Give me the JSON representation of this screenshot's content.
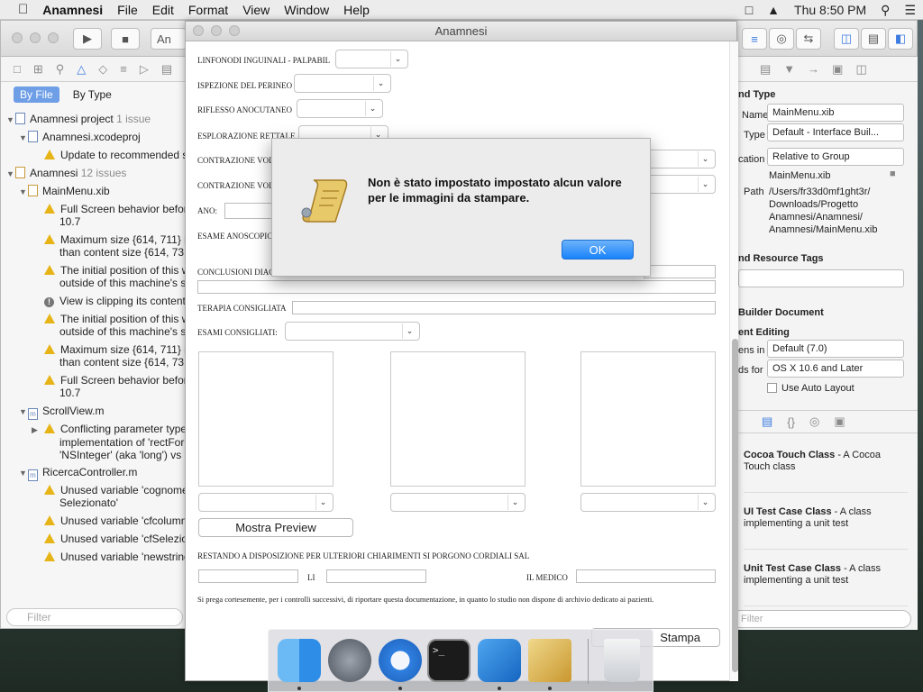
{
  "menubar": {
    "app_name": "Anamnesi",
    "menus": [
      "File",
      "Edit",
      "Format",
      "View",
      "Window",
      "Help"
    ],
    "clock": "Thu 8:50 PM"
  },
  "xcode": {
    "tab_partial": "An",
    "navigator": {
      "seg_by_file": "By File",
      "seg_by_type": "By Type",
      "rows": [
        {
          "text": "Anamnesi project",
          "badge": "1 issue",
          "type": "project"
        },
        {
          "text": "Anamnesi.xcodeproj",
          "type": "file"
        },
        {
          "text": "Update to recommended s",
          "type": "warning"
        },
        {
          "text": "Anamnesi",
          "badge": "12 issues",
          "type": "project"
        },
        {
          "text": "MainMenu.xib",
          "type": "file"
        },
        {
          "text": "Full Screen behavior before",
          "text2": "10.7",
          "type": "warning"
        },
        {
          "text": "Maximum size {614, 711} is",
          "text2": "than content size {614, 731",
          "type": "warning"
        },
        {
          "text": "The initial position of this w",
          "text2": "outside of this machine's s",
          "type": "warning"
        },
        {
          "text": "View is clipping its content",
          "type": "error"
        },
        {
          "text": "The initial position of this w",
          "text2": "outside of this machine's s",
          "type": "warning"
        },
        {
          "text": "Maximum size {614, 711} is",
          "text2": "than content size {614, 731",
          "type": "warning"
        },
        {
          "text": "Full Screen behavior before",
          "text2": "10.7",
          "type": "warning"
        },
        {
          "text": "ScrollView.m",
          "type": "file"
        },
        {
          "text": "Conflicting parameter type",
          "text2": "implementation of 'rectFor",
          "text3": "'NSInteger' (aka 'long') vs '",
          "type": "warning"
        },
        {
          "text": "RicercaController.m",
          "type": "file"
        },
        {
          "text": "Unused variable 'cognome",
          "text2": "Selezionato'",
          "type": "warning"
        },
        {
          "text": "Unused variable 'cfcolumn",
          "type": "warning"
        },
        {
          "text": "Unused variable 'cfSelezio",
          "type": "warning"
        },
        {
          "text": "Unused variable 'newstring",
          "type": "warning"
        }
      ],
      "filter_placeholder": "Filter"
    },
    "inspector": {
      "identity_header": "nd Type",
      "name_label": "Name",
      "name_value": "MainMenu.xib",
      "type_label": "Type",
      "type_value": "Default - Interface Buil...",
      "location_label": "cation",
      "location_value": "Relative to Group",
      "location_file": "MainMenu.xib",
      "path_label": "Path",
      "path_value": [
        "/Users/fr33d0mf1ght3r/",
        "Downloads/Progetto",
        "Anamnesi/Anamnesi/",
        "Anamnesi/MainMenu.xib"
      ],
      "resource_tags_header": "nd Resource Tags",
      "builder_doc_header": "Builder Document",
      "editing_header": "ent Editing",
      "opens_in_label": "ens in",
      "opens_in_value": "Default (7.0)",
      "builds_for_label": "ds for",
      "builds_for_value": "OS X 10.6 and Later",
      "auto_layout_label": "Use Auto Layout",
      "library": [
        {
          "title": "Cocoa Touch Class",
          "desc": " - A Cocoa Touch class"
        },
        {
          "title": "UI Test Case Class",
          "desc": " - A class implementing a unit test"
        },
        {
          "title": "Unit Test Case Class",
          "desc": " - A class implementing a unit test"
        }
      ],
      "filter_placeholder": "Filter"
    }
  },
  "anamnesi": {
    "title": "Anamnesi",
    "fields": {
      "linfonodi": "LINFONODI INGUINALI - PALPABIL",
      "ispezione": "ISPEZIONE DEL PERINEO",
      "riflesso": "RIFLESSO ANOCUTANEO",
      "esplorazione": "ESPLORAZIONE RETTALE",
      "contrazione1": "CONTRAZIONE VOL",
      "contrazione2": "CONTRAZIONE VOL",
      "ano": "ANO:",
      "esame": "ESAME ANOSCOPIC",
      "conclusioni": "CONCLUSIONI DIAG",
      "terapia": "TERAPIA CONSIGLIATA",
      "esami": "ESAMI CONSIGLIATI:",
      "restando": "RESTANDO A DISPOSIZIONE PER ULTERIORI CHIARIMENTI SI PORGONO CORDIALI SAL",
      "li": "LI",
      "medico": "IL MEDICO",
      "note": "Si prega cortesemente, per i controlli successivi, di riportare questa documentazione, in quanto lo studio non dispone di archivio dedicato ai pazienti."
    },
    "preview_button": "Mostra Preview",
    "print_button_partial": "Stampa"
  },
  "alert": {
    "message": "Non è stato impostato impostato alcun valore per le immagini da stampare.",
    "ok_label": "OK"
  },
  "dock": {
    "apps": [
      "finder",
      "launchpad",
      "safari",
      "terminal",
      "xcode",
      "script-editor",
      "trash"
    ]
  }
}
